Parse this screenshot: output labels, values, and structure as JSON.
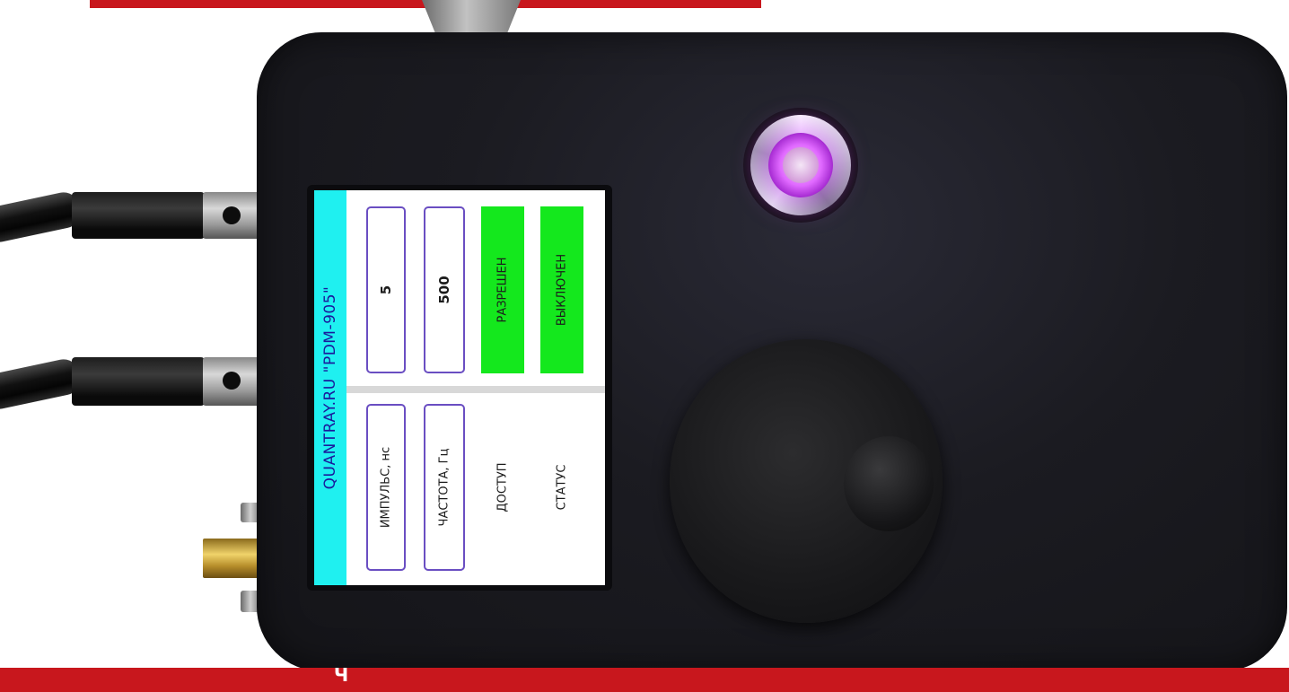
{
  "colors": {
    "brand_red": "#c8171d",
    "lcd_title_bar": "#1ff0f0",
    "status_green": "#14e81d",
    "indicator_led": "#d95bff"
  },
  "lcd": {
    "title": "QUANTRAY.RU \"PDM-905\"",
    "rows": [
      {
        "label": "ИМПУЛЬС, нс",
        "value": "5"
      },
      {
        "label": "ЧАСТОТА, Гц",
        "value": "500"
      },
      {
        "label": "ДОСТУП",
        "value": "РАЗРЕШЕН"
      },
      {
        "label": "СТАТУС",
        "value": "ВЫКЛЮЧЕН"
      }
    ]
  },
  "bottom_banner": {
    "text": "Ч"
  }
}
